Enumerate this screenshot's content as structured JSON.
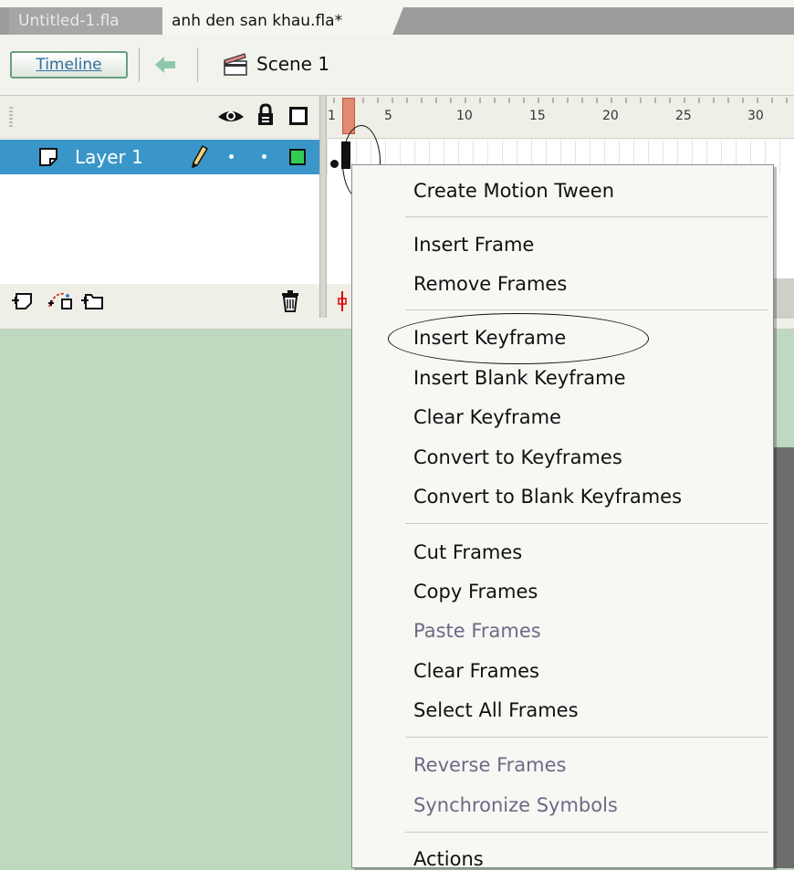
{
  "tabs": [
    {
      "label": "Untitled-1.fla",
      "active": false
    },
    {
      "label": "anh den san khau.fla*",
      "active": true
    }
  ],
  "editbar": {
    "timeline_label": "Timeline",
    "scene_label": "Scene 1"
  },
  "layers": [
    {
      "name": "Layer 1",
      "color": "#33cc55"
    }
  ],
  "ruler": {
    "labels": [
      "1",
      "5",
      "10",
      "15",
      "20",
      "25",
      "30"
    ]
  },
  "context_menu": {
    "items": [
      {
        "label": "Create Motion Tween",
        "enabled": true
      },
      {
        "label": "Insert Frame",
        "enabled": true
      },
      {
        "label": "Remove Frames",
        "enabled": true
      },
      {
        "label": "Insert Keyframe",
        "enabled": true
      },
      {
        "label": "Insert Blank Keyframe",
        "enabled": true
      },
      {
        "label": "Clear Keyframe",
        "enabled": true
      },
      {
        "label": "Convert to Keyframes",
        "enabled": true
      },
      {
        "label": "Convert to Blank Keyframes",
        "enabled": true
      },
      {
        "label": "Cut Frames",
        "enabled": true
      },
      {
        "label": "Copy Frames",
        "enabled": true
      },
      {
        "label": "Paste Frames",
        "enabled": false
      },
      {
        "label": "Clear Frames",
        "enabled": true
      },
      {
        "label": "Select All Frames",
        "enabled": true
      },
      {
        "label": "Reverse Frames",
        "enabled": false
      },
      {
        "label": "Synchronize Symbols",
        "enabled": false
      },
      {
        "label": "Actions",
        "enabled": true
      }
    ]
  },
  "colors": {
    "stage": "#bfd8c0",
    "layer_selected": "#3a96c8",
    "playhead": "#e08a70"
  }
}
